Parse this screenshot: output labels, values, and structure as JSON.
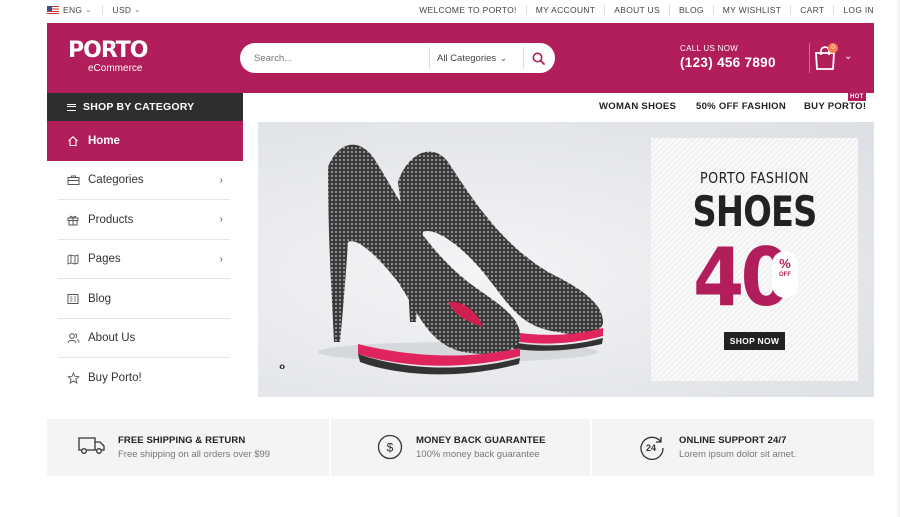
{
  "topbar": {
    "language": "ENG",
    "currency": "USD",
    "links": [
      "WELCOME TO PORTO!",
      "MY ACCOUNT",
      "ABOUT US",
      "BLOG",
      "MY WISHLIST",
      "CART",
      "LOG IN"
    ]
  },
  "header": {
    "logo_main": "PORTO",
    "logo_sub": "eCommerce",
    "search_placeholder": "Search...",
    "category_select": "All Categories",
    "call_label": "CALL US NOW",
    "phone": "(123) 456 7890",
    "cart_count": "0",
    "brand_color": "#b21e5c"
  },
  "sidebar": {
    "title": "SHOP BY CATEGORY",
    "items": [
      {
        "label": "Home",
        "icon": "home-icon"
      },
      {
        "label": "Categories",
        "icon": "briefcase-icon"
      },
      {
        "label": "Products",
        "icon": "gift-icon"
      },
      {
        "label": "Pages",
        "icon": "pages-icon"
      },
      {
        "label": "Blog",
        "icon": "blog-icon"
      },
      {
        "label": "About Us",
        "icon": "users-icon"
      },
      {
        "label": "Buy Porto!",
        "icon": "star-icon"
      }
    ]
  },
  "nav": {
    "links": [
      "WOMAN SHOES",
      "50% OFF FASHION",
      "BUY PORTO!"
    ],
    "hot_badge": "HOT"
  },
  "banner": {
    "line1": "PORTO FASHION",
    "line2": "SHOES",
    "discount": "40",
    "percent": "%",
    "off": "OFF",
    "cta": "SHOP NOW",
    "slider_nav": "‹›"
  },
  "features": [
    {
      "title": "FREE SHIPPING & RETURN",
      "desc": "Free shipping on all orders over $99",
      "icon": "truck-icon"
    },
    {
      "title": "MONEY BACK GUARANTEE",
      "desc": "100% money back guarantee",
      "icon": "dollar-icon"
    },
    {
      "title": "ONLINE SUPPORT 24/7",
      "desc": "Lorem ipsum dolor sit amet.",
      "icon": "support-24-icon"
    }
  ]
}
